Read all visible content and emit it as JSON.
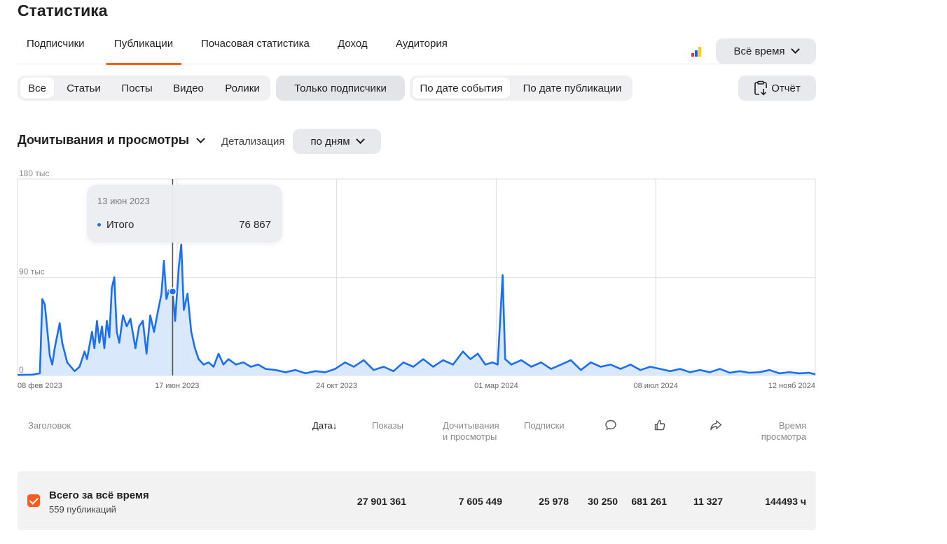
{
  "page": {
    "title": "Статистика"
  },
  "tabs": [
    {
      "label": "Подписчики",
      "active": false
    },
    {
      "label": "Публикации",
      "active": true
    },
    {
      "label": "Почасовая статистика",
      "active": false
    },
    {
      "label": "Доход",
      "active": false
    },
    {
      "label": "Аудитория",
      "active": false
    }
  ],
  "period_select": {
    "label": "Всё время"
  },
  "content_filter": {
    "items": [
      "Все",
      "Статьи",
      "Посты",
      "Видео",
      "Ролики"
    ],
    "selected": "Все"
  },
  "subscribers_only": {
    "label": "Только подписчики"
  },
  "date_mode": {
    "items": [
      "По дате события",
      "По дате публикации"
    ],
    "selected": "По дате события"
  },
  "report_button": {
    "label": "Отчёт"
  },
  "metric": {
    "label": "Дочитывания и просмотры"
  },
  "detail": {
    "label": "Детализация",
    "value": "по дням"
  },
  "colors": {
    "accent": "#ff5a1f",
    "line": "#1a6ff5",
    "fill": "#d6e6fb",
    "grid": "#dcdcdc"
  },
  "tooltip": {
    "date": "13 июн 2023",
    "series": "Итого",
    "value": "76 867"
  },
  "chart_data": {
    "type": "area",
    "y_ticks": [
      "180 тыс",
      "90 тыс",
      "0"
    ],
    "x_ticks": [
      "08 фев 2023",
      "17 июн 2023",
      "24 окт 2023",
      "01 мар 2024",
      "08 июл 2024",
      "12 нояб 2024"
    ],
    "ylim": [
      0,
      180000
    ],
    "grid": true,
    "x_start": "2023-02-08",
    "x_end": "2024-11-12",
    "highlight": {
      "date": "2023-06-13",
      "value": 76867
    },
    "series": [
      {
        "name": "Итого",
        "points": [
          [
            "2023-02-08",
            500
          ],
          [
            "2023-02-20",
            800
          ],
          [
            "2023-02-26",
            2000
          ],
          [
            "2023-02-28",
            70000
          ],
          [
            "2023-03-02",
            65000
          ],
          [
            "2023-03-06",
            18000
          ],
          [
            "2023-03-08",
            10000
          ],
          [
            "2023-03-10",
            25000
          ],
          [
            "2023-03-14",
            48000
          ],
          [
            "2023-03-16",
            30000
          ],
          [
            "2023-03-20",
            12000
          ],
          [
            "2023-03-26",
            4000
          ],
          [
            "2023-03-30",
            8000
          ],
          [
            "2023-04-03",
            22000
          ],
          [
            "2023-04-05",
            15000
          ],
          [
            "2023-04-09",
            40000
          ],
          [
            "2023-04-11",
            25000
          ],
          [
            "2023-04-13",
            50000
          ],
          [
            "2023-04-15",
            30000
          ],
          [
            "2023-04-17",
            45000
          ],
          [
            "2023-04-19",
            25000
          ],
          [
            "2023-04-21",
            50000
          ],
          [
            "2023-04-23",
            35000
          ],
          [
            "2023-04-25",
            80000
          ],
          [
            "2023-04-27",
            90000
          ],
          [
            "2023-04-29",
            40000
          ],
          [
            "2023-05-01",
            30000
          ],
          [
            "2023-05-04",
            55000
          ],
          [
            "2023-05-07",
            45000
          ],
          [
            "2023-05-10",
            52000
          ],
          [
            "2023-05-14",
            25000
          ],
          [
            "2023-05-17",
            45000
          ],
          [
            "2023-05-20",
            50000
          ],
          [
            "2023-05-23",
            20000
          ],
          [
            "2023-05-26",
            55000
          ],
          [
            "2023-05-29",
            40000
          ],
          [
            "2023-06-01",
            58000
          ],
          [
            "2023-06-04",
            75000
          ],
          [
            "2023-06-06",
            105000
          ],
          [
            "2023-06-08",
            70000
          ],
          [
            "2023-06-10",
            78000
          ],
          [
            "2023-06-13",
            76867
          ],
          [
            "2023-06-15",
            50000
          ],
          [
            "2023-06-18",
            100000
          ],
          [
            "2023-06-20",
            120000
          ],
          [
            "2023-06-22",
            60000
          ],
          [
            "2023-06-25",
            75000
          ],
          [
            "2023-06-28",
            40000
          ],
          [
            "2023-07-01",
            25000
          ],
          [
            "2023-07-04",
            15000
          ],
          [
            "2023-07-08",
            10000
          ],
          [
            "2023-07-12",
            12000
          ],
          [
            "2023-07-16",
            8000
          ],
          [
            "2023-07-20",
            20000
          ],
          [
            "2023-07-24",
            10000
          ],
          [
            "2023-07-28",
            15000
          ],
          [
            "2023-08-03",
            10000
          ],
          [
            "2023-08-09",
            12000
          ],
          [
            "2023-08-15",
            8000
          ],
          [
            "2023-08-21",
            10000
          ],
          [
            "2023-08-27",
            6000
          ],
          [
            "2023-09-04",
            5000
          ],
          [
            "2023-09-12",
            3000
          ],
          [
            "2023-09-20",
            5000
          ],
          [
            "2023-09-28",
            2000
          ],
          [
            "2023-10-06",
            4000
          ],
          [
            "2023-10-14",
            3000
          ],
          [
            "2023-10-22",
            6000
          ],
          [
            "2023-10-30",
            12000
          ],
          [
            "2023-11-06",
            8000
          ],
          [
            "2023-11-14",
            14000
          ],
          [
            "2023-11-22",
            5000
          ],
          [
            "2023-11-30",
            8000
          ],
          [
            "2023-12-08",
            4000
          ],
          [
            "2023-12-16",
            12000
          ],
          [
            "2023-12-24",
            8000
          ],
          [
            "2024-01-01",
            15000
          ],
          [
            "2024-01-09",
            8000
          ],
          [
            "2024-01-17",
            14000
          ],
          [
            "2024-01-25",
            10000
          ],
          [
            "2024-02-02",
            22000
          ],
          [
            "2024-02-08",
            15000
          ],
          [
            "2024-02-14",
            20000
          ],
          [
            "2024-02-20",
            10000
          ],
          [
            "2024-02-26",
            12000
          ],
          [
            "2024-03-01",
            10000
          ],
          [
            "2024-03-05",
            92000
          ],
          [
            "2024-03-07",
            15000
          ],
          [
            "2024-03-12",
            10000
          ],
          [
            "2024-03-20",
            14000
          ],
          [
            "2024-03-28",
            8000
          ],
          [
            "2024-04-05",
            12000
          ],
          [
            "2024-04-13",
            6000
          ],
          [
            "2024-04-21",
            10000
          ],
          [
            "2024-04-29",
            14000
          ],
          [
            "2024-05-07",
            5000
          ],
          [
            "2024-05-15",
            12000
          ],
          [
            "2024-05-23",
            8000
          ],
          [
            "2024-05-31",
            10000
          ],
          [
            "2024-06-08",
            6000
          ],
          [
            "2024-06-16",
            10000
          ],
          [
            "2024-06-24",
            5000
          ],
          [
            "2024-07-02",
            8000
          ],
          [
            "2024-07-10",
            6000
          ],
          [
            "2024-07-18",
            4000
          ],
          [
            "2024-07-26",
            6000
          ],
          [
            "2024-08-03",
            3000
          ],
          [
            "2024-08-11",
            5000
          ],
          [
            "2024-08-19",
            3000
          ],
          [
            "2024-08-27",
            6000
          ],
          [
            "2024-09-04",
            2500
          ],
          [
            "2024-09-12",
            4000
          ],
          [
            "2024-09-20",
            2500
          ],
          [
            "2024-09-28",
            3000
          ],
          [
            "2024-10-06",
            5000
          ],
          [
            "2024-10-14",
            2000
          ],
          [
            "2024-10-22",
            3000
          ],
          [
            "2024-10-30",
            2000
          ],
          [
            "2024-11-07",
            2500
          ],
          [
            "2024-11-12",
            1000
          ]
        ]
      }
    ]
  },
  "table": {
    "headers": {
      "title": "Заголовок",
      "date": "Дата",
      "sort_arrow": "↓",
      "impressions": "Показы",
      "reads_1": "Дочитывания",
      "reads_2": "и просмотры",
      "subscriptions": "Подписки",
      "time_1": "Время",
      "time_2": "просмотра"
    },
    "icons": [
      "comment-icon",
      "like-icon",
      "share-icon"
    ],
    "total": {
      "title": "Всего за всё время",
      "subtitle": "559 публикаций",
      "impressions": "27 901 361",
      "reads": "7 605 449",
      "subscriptions": "25 978",
      "comments": "30 250",
      "likes": "681 261",
      "shares": "11 327",
      "time": "144493 ч"
    }
  }
}
